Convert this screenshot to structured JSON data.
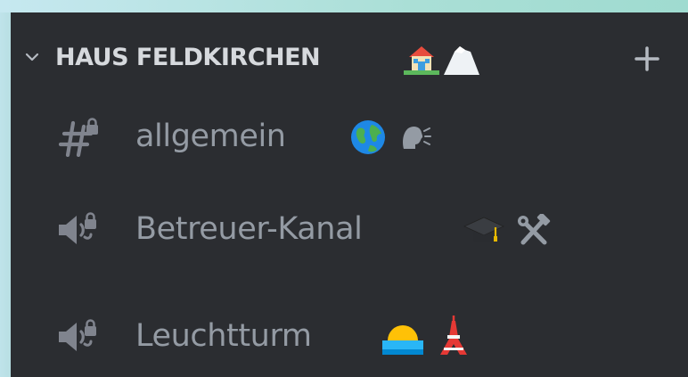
{
  "category": {
    "chevron_icon": "chevron-down-icon",
    "title": "HAUS FELDKIRCHEN",
    "emoji": [
      "house-emoji",
      "snow-mountain-emoji"
    ],
    "add_icon": "plus-icon"
  },
  "channels": [
    {
      "type": "text-locked",
      "icon": "locked-text-channel-icon",
      "label": "allgemein",
      "emoji": [
        "globe-emoji",
        "speaking-head-emoji"
      ]
    },
    {
      "type": "voice-locked",
      "icon": "locked-voice-channel-icon",
      "label": "Betreuer-Kanal",
      "emoji": [
        "graduation-cap-emoji",
        "hammer-wrench-emoji"
      ]
    },
    {
      "type": "voice-locked",
      "icon": "locked-voice-channel-icon",
      "label": "Leuchtturm",
      "emoji": [
        "sunrise-emoji",
        "tower-emoji"
      ]
    }
  ],
  "colors": {
    "panel_bg": "#2b2d31",
    "category_text": "#d6d9dd",
    "channel_text": "#949ba4",
    "icon": "#80848e"
  }
}
